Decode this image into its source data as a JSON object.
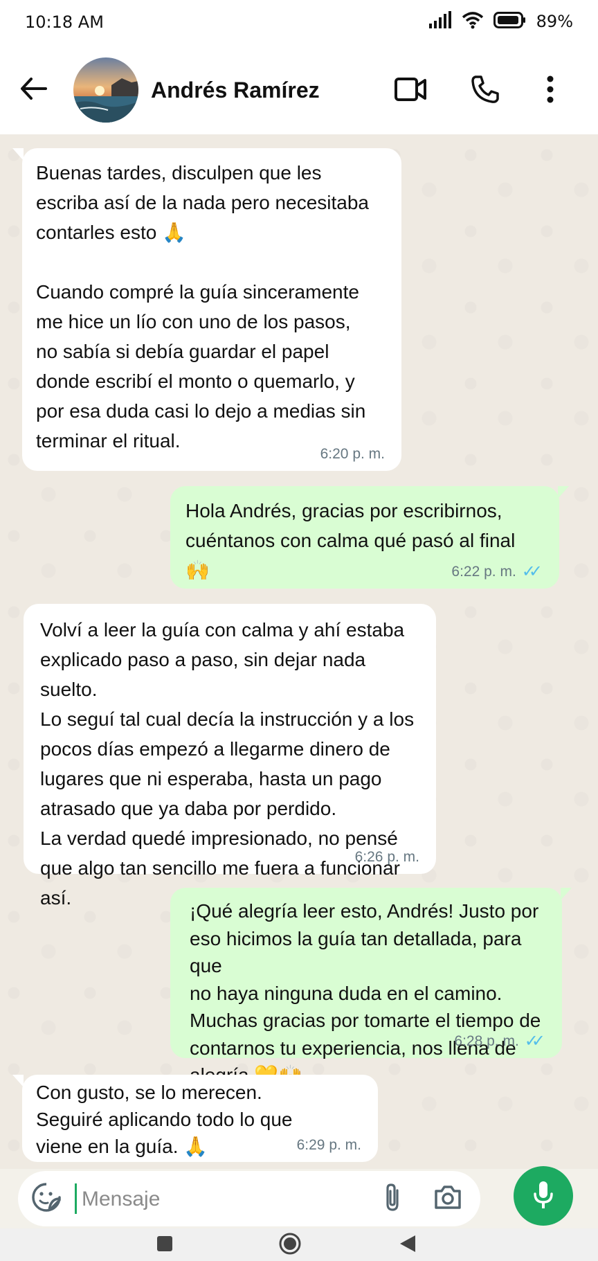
{
  "status_bar": {
    "time": "10:18 AM",
    "battery_percent": "89%",
    "icons": [
      "signal-icon",
      "wifi-icon",
      "battery-icon"
    ]
  },
  "header": {
    "contact_name": "Andrés Ramírez",
    "icons": [
      "back-arrow-icon",
      "video-call-icon",
      "phone-icon",
      "more-options-icon"
    ]
  },
  "messages": [
    {
      "direction": "incoming",
      "text": "Buenas tardes, disculpen que les\nescriba así de la nada pero necesitaba\ncontarles esto 🙏\n\nCuando compré la guía sinceramente\nme hice un lío con uno de los pasos,\nno sabía si debía guardar el papel\ndonde escribí el monto o quemarlo, y\npor esa duda casi lo dejo a medias sin\nterminar el ritual.",
      "time": "6:20 p. m."
    },
    {
      "direction": "outgoing",
      "text": "Hola Andrés, gracias por escribirnos,\ncuéntanos con calma qué pasó al final 🙌",
      "time": "6:22 p. m.",
      "read": true
    },
    {
      "direction": "incoming",
      "text": "Volví a leer la guía con calma y ahí estaba\nexplicado paso a paso, sin dejar nada suelto.\nLo seguí tal cual decía la instrucción y a los\npocos días empezó a llegarme dinero de\nlugares que ni esperaba, hasta un pago\natrasado que ya daba por perdido.\nLa verdad quedé impresionado, no pensé\nque algo tan sencillo me fuera a funcionar así.",
      "time": "6:26 p. m."
    },
    {
      "direction": "outgoing",
      "text": "¡Qué alegría leer esto, Andrés! Justo por\neso hicimos la guía tan detallada, para que\nno haya ninguna duda en el camino.\nMuchas gracias por tomarte el tiempo de\ncontarnos tu experiencia, nos llena de\nalegría 💛🙌",
      "time": "6:28 p. m.",
      "read": true
    },
    {
      "direction": "incoming",
      "text": "Con gusto, se lo merecen.\nSeguiré aplicando todo lo que\nviene en la guía. 🙏",
      "time": "6:29 p. m."
    }
  ],
  "composer": {
    "placeholder": "Mensaje",
    "icons": [
      "emoji-sticker-icon",
      "attach-icon",
      "camera-icon",
      "microphone-icon"
    ]
  },
  "colors": {
    "outgoing_bubble": "#d9fdd3",
    "incoming_bubble": "#ffffff",
    "chat_background": "#efeae2",
    "accent_green": "#1daa61",
    "read_ticks": "#53bdeb"
  }
}
